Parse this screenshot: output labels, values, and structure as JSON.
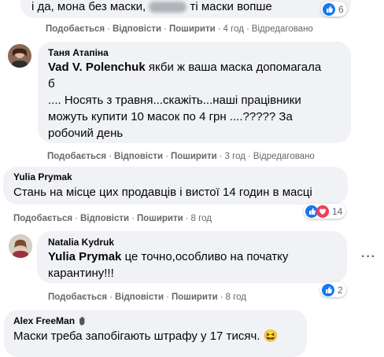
{
  "comments": [
    {
      "text_a": "і да, мона без маски,",
      "text_b": "ті маски вопше",
      "reactions_count": "6",
      "actions": {
        "like": "Подобається",
        "reply": "Відповісти",
        "share": "Поширити",
        "time": "4 год",
        "edited": "Відредаговано"
      }
    },
    {
      "author": "Таня Атапіна",
      "mention": "Vad V. Polenchuk",
      "line1": "якби ж ваша маска допомагала",
      "line2": "б",
      "line3": ".... Носять з травня...скажіть...наші працівники",
      "line4": "можуть купити 10 масок по 4 грн ....????? За",
      "line5": "робочий день",
      "actions": {
        "like": "Подобається",
        "reply": "Відповісти",
        "share": "Поширити",
        "time": "3 год",
        "edited": "Відредаговано"
      }
    },
    {
      "author": "Yulia Prymak",
      "line1": "Стань на місце цих продавців і вистої 14 годин в масці",
      "reactions_count": "14",
      "actions": {
        "like": "Подобається",
        "reply": "Відповісти",
        "share": "Поширити",
        "time": "8 год"
      }
    },
    {
      "author": "Natalia Kydruk",
      "mention": "Yulia Prymak",
      "line1": "це точно,особливо на початку",
      "line2": "карантину!!!",
      "reactions_count": "2",
      "more": "···",
      "actions": {
        "like": "Подобається",
        "reply": "Відповісти",
        "share": "Поширити",
        "time": "8 год"
      }
    },
    {
      "author": "Alex FreeMan",
      "line1": "Маски треба запобігають штрафу у 17 тисяч.",
      "emoji": "😆"
    }
  ],
  "colors": {
    "bubble": "#f0f2f5",
    "like": "#1877f2",
    "love": "#f33e58",
    "meta": "#65676b"
  }
}
